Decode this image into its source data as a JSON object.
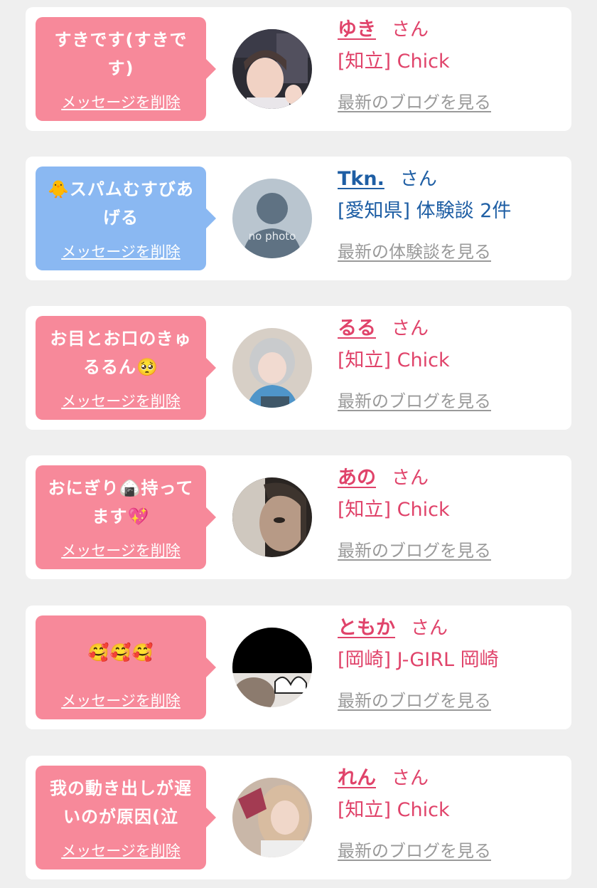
{
  "messages": [
    {
      "bubble_color": "#f7899a",
      "message": "すきです(すきです)",
      "delete_label": "メッセージを削除",
      "name": "ゆき",
      "honorific": "さん",
      "detail": "[知立] Chick",
      "link": "最新のブログを見る",
      "text_color": "#e0436a"
    },
    {
      "bubble_color": "#8ab8f2",
      "message": "🐥スパムむすびあげる",
      "delete_label": "メッセージを削除",
      "name": "Tkn.",
      "honorific": "さん",
      "detail": "[愛知県] 体験談 2件",
      "link": "最新の体験談を見る",
      "avatar_text": "no photo",
      "text_color": "#1e5ea4"
    },
    {
      "bubble_color": "#f7899a",
      "message": "お目とお口のきゅるるん🥺",
      "delete_label": "メッセージを削除",
      "name": "るる",
      "honorific": "さん",
      "detail": "[知立] Chick",
      "link": "最新のブログを見る",
      "text_color": "#e0436a"
    },
    {
      "bubble_color": "#f7899a",
      "message": "おにぎり🍙持ってます💖",
      "delete_label": "メッセージを削除",
      "name": "あの",
      "honorific": "さん",
      "detail": "[知立] Chick",
      "link": "最新のブログを見る",
      "text_color": "#e0436a"
    },
    {
      "bubble_color": "#f7899a",
      "message": "🥰🥰🥰",
      "delete_label": "メッセージを削除",
      "name": "ともか",
      "honorific": "さん",
      "detail": "[岡崎] J-GIRL 岡崎",
      "link": "最新のブログを見る",
      "text_color": "#e0436a"
    },
    {
      "bubble_color": "#f7899a",
      "message": "我の動き出しが遅いのが原因(泣",
      "delete_label": "メッセージを削除",
      "name": "れん",
      "honorific": "さん",
      "detail": "[知立] Chick",
      "link": "最新のブログを見る",
      "text_color": "#e0436a"
    }
  ]
}
